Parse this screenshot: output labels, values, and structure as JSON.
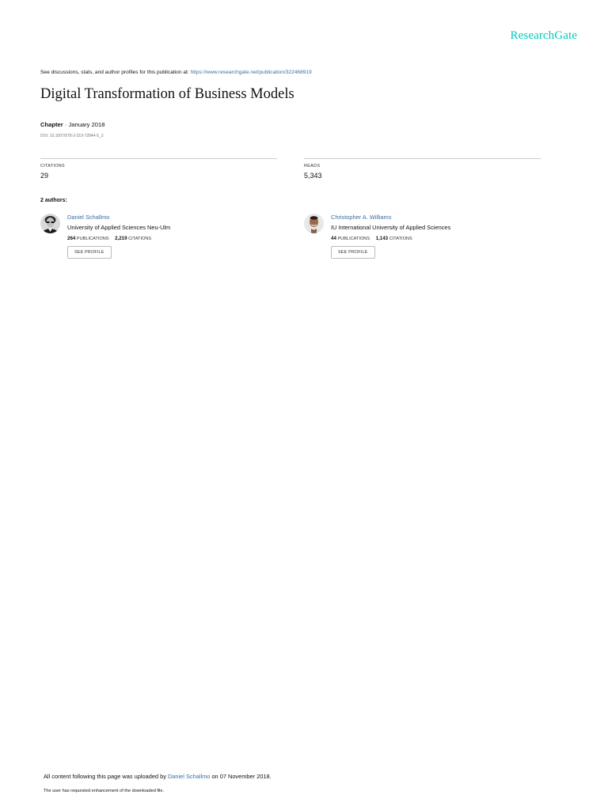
{
  "brand": {
    "logo_text": "ResearchGate",
    "accent_color": "#00ccbb",
    "link_color": "#3a6ea5"
  },
  "header": {
    "discussion_prefix": "See discussions, stats, and author profiles for this publication at:",
    "publication_url": "https://www.researchgate.net/publication/322468919"
  },
  "publication": {
    "title": "Digital Transformation of Business Models",
    "type": "Chapter",
    "separator": " · ",
    "date": "January 2018",
    "doi": "DOI: 10.1007/978-3-319-72844-5_3"
  },
  "stats": {
    "citations_label": "CITATIONS",
    "citations_value": "29",
    "reads_label": "READS",
    "reads_value": "5,343"
  },
  "authors_heading": "2 authors:",
  "authors": [
    {
      "name": "Daniel Schallmo",
      "institution": "University of Applied Sciences Neu-Ulm",
      "publications_count": "264",
      "publications_label": "PUBLICATIONS",
      "citations_count": "2,219",
      "citations_label": "CITATIONS",
      "button_label": "SEE PROFILE",
      "avatar_icon": "author-photo-icon"
    },
    {
      "name": "Christopher A. Williams",
      "institution": "IU International University of Applied Sciences",
      "publications_count": "44",
      "publications_label": "PUBLICATIONS",
      "citations_count": "1,143",
      "citations_label": "CITATIONS",
      "button_label": "SEE PROFILE",
      "avatar_icon": "author-photo-icon"
    }
  ],
  "footer": {
    "upload_prefix": "All content following this page was uploaded by",
    "uploader": "Daniel Schallmo",
    "upload_suffix": "on 07 November 2018.",
    "note": "The user has requested enhancement of the downloaded file."
  }
}
